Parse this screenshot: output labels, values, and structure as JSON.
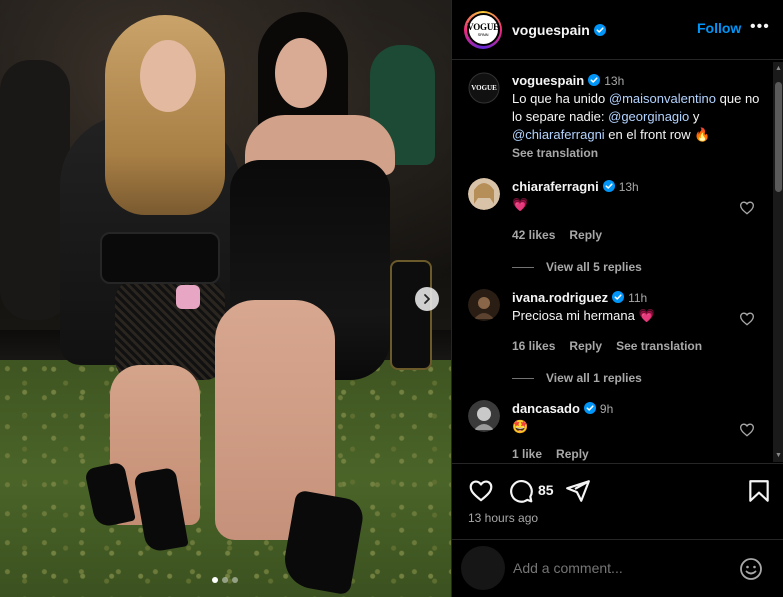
{
  "post": {
    "image_alt": "Two women seated front row at a fashion show",
    "carousel": {
      "total": 3,
      "active_index": 0
    }
  },
  "header": {
    "avatar_text": "VOGUE",
    "avatar_subtext": "SPAIN",
    "username": "voguespain",
    "follow_label": "Follow",
    "more_label": "•••"
  },
  "caption": {
    "username": "voguespain",
    "time": "13h",
    "text_1": "Lo que ha unido ",
    "mention_1": "@maisonvalentino",
    "text_2": " que no lo separe nadie: ",
    "mention_2": "@georginagio",
    "text_3": " y ",
    "mention_3": "@chiaraferragni",
    "text_4": " en el front row 🔥",
    "see_translation": "See translation"
  },
  "comments": [
    {
      "username": "chiaraferragni",
      "time": "13h",
      "text": "💗",
      "likes": "42 likes",
      "reply": "Reply",
      "translation": "",
      "view_replies": "View all 5 replies"
    },
    {
      "username": "ivana.rodriguez",
      "time": "11h",
      "text": "Preciosa mi hermana 💗",
      "likes": "16 likes",
      "reply": "Reply",
      "translation": "See translation",
      "view_replies": "View all 1 replies"
    },
    {
      "username": "dancasado",
      "time": "9h",
      "text": "🤩",
      "likes": "1 like",
      "reply": "Reply",
      "translation": "",
      "view_replies": ""
    }
  ],
  "actions": {
    "comment_count": "85",
    "time_ago": "13 hours ago",
    "icons": [
      "heart-icon",
      "comment-icon",
      "share-icon",
      "bookmark-icon"
    ]
  },
  "add_comment": {
    "placeholder": "Add a comment..."
  },
  "colors": {
    "accent": "#0095f6",
    "verified": "#0095f6",
    "secondary_text": "#a8a8a8",
    "mention": "#b3d3ff"
  }
}
